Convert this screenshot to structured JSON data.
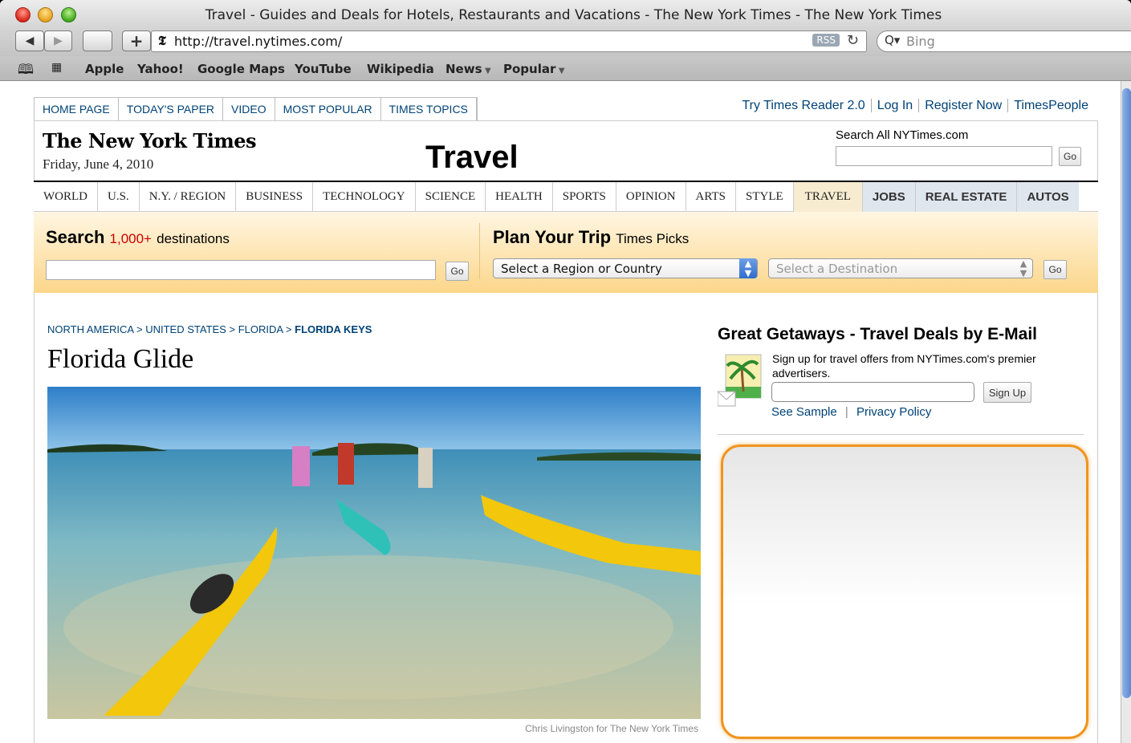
{
  "window": {
    "title": "Travel - Guides and Deals for Hotels, Restaurants and Vacations - The New York Times - The New York Times"
  },
  "toolbar": {
    "url": "http://travel.nytimes.com/",
    "rss": "RSS",
    "search_placeholder": "Bing"
  },
  "bookmarks": [
    "Apple",
    "Yahoo!",
    "Google Maps",
    "YouTube",
    "Wikipedia",
    "News",
    "Popular"
  ],
  "topnav": [
    "HOME PAGE",
    "TODAY'S PAPER",
    "VIDEO",
    "MOST POPULAR",
    "TIMES TOPICS"
  ],
  "toplinks": [
    "Try Times Reader 2.0",
    "Log In",
    "Register Now",
    "TimesPeople"
  ],
  "masthead": {
    "logo": "The New York Times",
    "date": "Friday, June 4, 2010",
    "section": "Travel",
    "search_label": "Search All NYTimes.com",
    "go": "Go"
  },
  "sections": [
    "WORLD",
    "U.S.",
    "N.Y. / REGION",
    "BUSINESS",
    "TECHNOLOGY",
    "SCIENCE",
    "HEALTH",
    "SPORTS",
    "OPINION",
    "ARTS",
    "STYLE",
    "TRAVEL",
    "JOBS",
    "REAL ESTATE",
    "AUTOS"
  ],
  "search_panel": {
    "title": "Search",
    "count": "1,000+",
    "rest": "destinations",
    "go": "Go"
  },
  "plan_panel": {
    "title": "Plan Your Trip",
    "sub": "Times Picks",
    "region_select": "Select a Region or Country",
    "dest_select": "Select a Destination",
    "go": "Go"
  },
  "breadcrumb": [
    "NORTH AMERICA",
    "UNITED STATES",
    "FLORIDA",
    "FLORIDA KEYS"
  ],
  "article": {
    "headline": "Florida Glide",
    "caption": "Chris Livingston for The New York Times"
  },
  "getaways": {
    "title": "Great Getaways - Travel Deals by E-Mail",
    "text": "Sign up for travel offers from NYTimes.com's premier advertisers.",
    "signup": "Sign Up",
    "see_sample": "See Sample",
    "privacy": "Privacy Policy"
  }
}
